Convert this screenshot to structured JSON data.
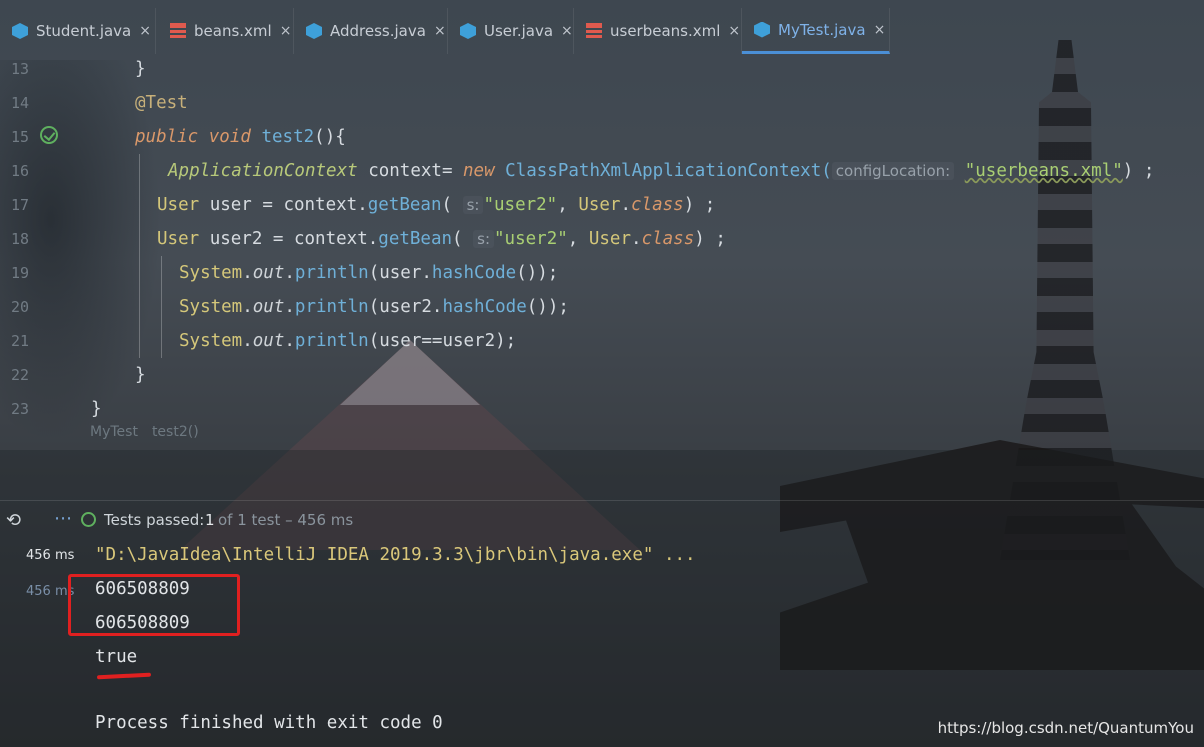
{
  "tabs": [
    {
      "label": "Student.java",
      "icon": "java-class-icon"
    },
    {
      "label": "beans.xml",
      "icon": "xml-file-icon"
    },
    {
      "label": "Address.java",
      "icon": "java-class-icon"
    },
    {
      "label": "User.java",
      "icon": "java-class-icon"
    },
    {
      "label": "userbeans.xml",
      "icon": "xml-file-icon"
    },
    {
      "label": "MyTest.java",
      "icon": "java-test-class-icon",
      "active": true
    }
  ],
  "close_glyph": "×",
  "editor": {
    "line_numbers": [
      "13",
      "14",
      "15",
      "16",
      "17",
      "18",
      "19",
      "20",
      "21",
      "22",
      "23"
    ],
    "lines": {
      "l13": "}",
      "l14": "@Test",
      "l15_public": "public",
      "l15_void": "void",
      "l15_name": "test2",
      "l15_rest": "(){",
      "l16_type": "ApplicationContext",
      "l16_var": " context= ",
      "l16_new": "new",
      "l16_cls": " ClassPathXmlApplicationContext(",
      "l16_hint": "configLocation:",
      "l16_str": "\"userbeans.xml\"",
      "l16_end": ") ;",
      "l17_type": "User",
      "l17_var": " user = context.",
      "l17_fn": "getBean",
      "l17_open": "(",
      "l17_hint": "s:",
      "l17_str": "\"user2\"",
      "l17_sep": ", ",
      "l17_cls": "User",
      "l17_dot": ".",
      "l17_kw": "class",
      "l17_end": ") ;",
      "l18_type": "User",
      "l18_var": " user2 = context.",
      "l18_fn": "getBean",
      "l18_open": "(",
      "l18_hint": "s:",
      "l18_str": "\"user2\"",
      "l18_sep": ", ",
      "l18_cls": "User",
      "l18_dot": ".",
      "l18_kw": "class",
      "l18_end": ") ;",
      "sys": "System",
      "dot": ".",
      "out": "out",
      "println": "println",
      "l19_arg": "(user.",
      "hash": "hashCode",
      "l19_end": "());",
      "l20_arg": "(user2.",
      "l20_end": "());",
      "l21_arg": "(user==user2);",
      "l22": "}",
      "l23": "}"
    },
    "breadcrumb": [
      "MyTest",
      "test2()"
    ]
  },
  "run": {
    "status_label": "Tests passed:",
    "passed": "1",
    "detail": "of 1 test – 456 ms",
    "times": [
      "456 ms",
      "456 ms"
    ],
    "output": [
      "\"D:\\JavaIdea\\IntelliJ IDEA 2019.3.3\\jbr\\bin\\java.exe\" ...",
      "606508809",
      "606508809",
      "true",
      "Process finished with exit code 0"
    ]
  },
  "watermark": "https://blog.csdn.net/QuantumYou",
  "colors": {
    "accent": "#4b8fd6",
    "pass": "#5fb05f",
    "annotation_red": "#e02020"
  }
}
